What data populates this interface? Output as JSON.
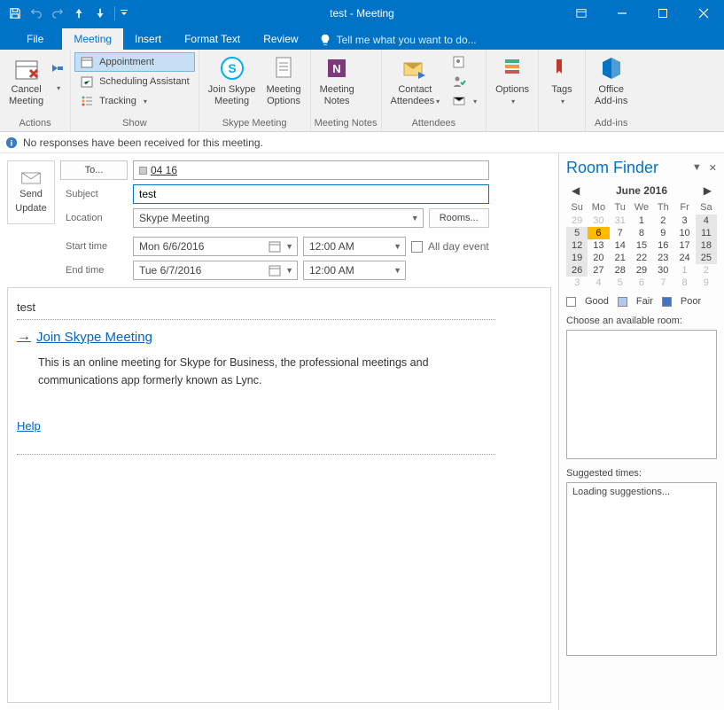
{
  "titlebar": {
    "title": "test - Meeting"
  },
  "tabs": {
    "file": "File",
    "meeting": "Meeting",
    "insert": "Insert",
    "format": "Format Text",
    "review": "Review",
    "tellme": "Tell me what you want to do..."
  },
  "ribbon": {
    "actions": {
      "cancel": "Cancel\nMeeting",
      "group": "Actions"
    },
    "show": {
      "appointment": "Appointment",
      "scheduling": "Scheduling Assistant",
      "tracking": "Tracking",
      "group": "Show"
    },
    "skype": {
      "join": "Join Skype\nMeeting",
      "options": "Meeting\nOptions",
      "group": "Skype Meeting"
    },
    "notes": {
      "meeting_notes": "Meeting\nNotes",
      "group": "Meeting Notes"
    },
    "attendees": {
      "contact": "Contact\nAttendees",
      "group": "Attendees"
    },
    "options": {
      "options": "Options"
    },
    "tags": {
      "tags": "Tags"
    },
    "addins": {
      "office": "Office\nAdd-ins",
      "group": "Add-ins"
    }
  },
  "infobar": {
    "msg": "No responses have been received for this meeting."
  },
  "form": {
    "send": {
      "l1": "Send",
      "l2": "Update"
    },
    "to_label": "To...",
    "to_value": "04 16",
    "subject_label": "Subject",
    "subject_value": "test",
    "location_label": "Location",
    "location_value": "Skype Meeting",
    "rooms_btn": "Rooms...",
    "start_label": "Start time",
    "start_date": "Mon 6/6/2016",
    "start_time": "12:00 AM",
    "end_label": "End time",
    "end_date": "Tue 6/7/2016",
    "end_time": "12:00 AM",
    "allday": "All day event"
  },
  "body": {
    "heading": "test",
    "skype_link": "Join Skype Meeting",
    "desc": "This is an online meeting for Skype for Business, the professional meetings and communications app formerly known as Lync.",
    "help": "Help"
  },
  "pane": {
    "title": "Room Finder",
    "month": "June 2016",
    "dow": [
      "Su",
      "Mo",
      "Tu",
      "We",
      "Th",
      "Fr",
      "Sa"
    ],
    "weeks": [
      [
        {
          "n": 29,
          "cls": "off"
        },
        {
          "n": 30,
          "cls": "off"
        },
        {
          "n": 31,
          "cls": "off"
        },
        {
          "n": 1
        },
        {
          "n": 2
        },
        {
          "n": 3
        },
        {
          "n": 4,
          "cls": "range"
        }
      ],
      [
        {
          "n": 5,
          "cls": "range"
        },
        {
          "n": 6,
          "cls": "today"
        },
        {
          "n": 7
        },
        {
          "n": 8
        },
        {
          "n": 9
        },
        {
          "n": 10
        },
        {
          "n": 11,
          "cls": "range"
        }
      ],
      [
        {
          "n": 12,
          "cls": "range"
        },
        {
          "n": 13
        },
        {
          "n": 14
        },
        {
          "n": 15
        },
        {
          "n": 16
        },
        {
          "n": 17
        },
        {
          "n": 18,
          "cls": "range"
        }
      ],
      [
        {
          "n": 19,
          "cls": "range"
        },
        {
          "n": 20
        },
        {
          "n": 21
        },
        {
          "n": 22
        },
        {
          "n": 23
        },
        {
          "n": 24
        },
        {
          "n": 25,
          "cls": "range"
        }
      ],
      [
        {
          "n": 26,
          "cls": "range"
        },
        {
          "n": 27
        },
        {
          "n": 28
        },
        {
          "n": 29
        },
        {
          "n": 30
        },
        {
          "n": 1,
          "cls": "off"
        },
        {
          "n": 2,
          "cls": "off"
        }
      ],
      [
        {
          "n": 3,
          "cls": "off"
        },
        {
          "n": 4,
          "cls": "off"
        },
        {
          "n": 5,
          "cls": "off"
        },
        {
          "n": 6,
          "cls": "off"
        },
        {
          "n": 7,
          "cls": "off"
        },
        {
          "n": 8,
          "cls": "off"
        },
        {
          "n": 9,
          "cls": "off"
        }
      ]
    ],
    "legend": {
      "good": "Good",
      "fair": "Fair",
      "poor": "Poor"
    },
    "rooms_label": "Choose an available room:",
    "sugg_label": "Suggested times:",
    "sugg_loading": "Loading suggestions..."
  }
}
